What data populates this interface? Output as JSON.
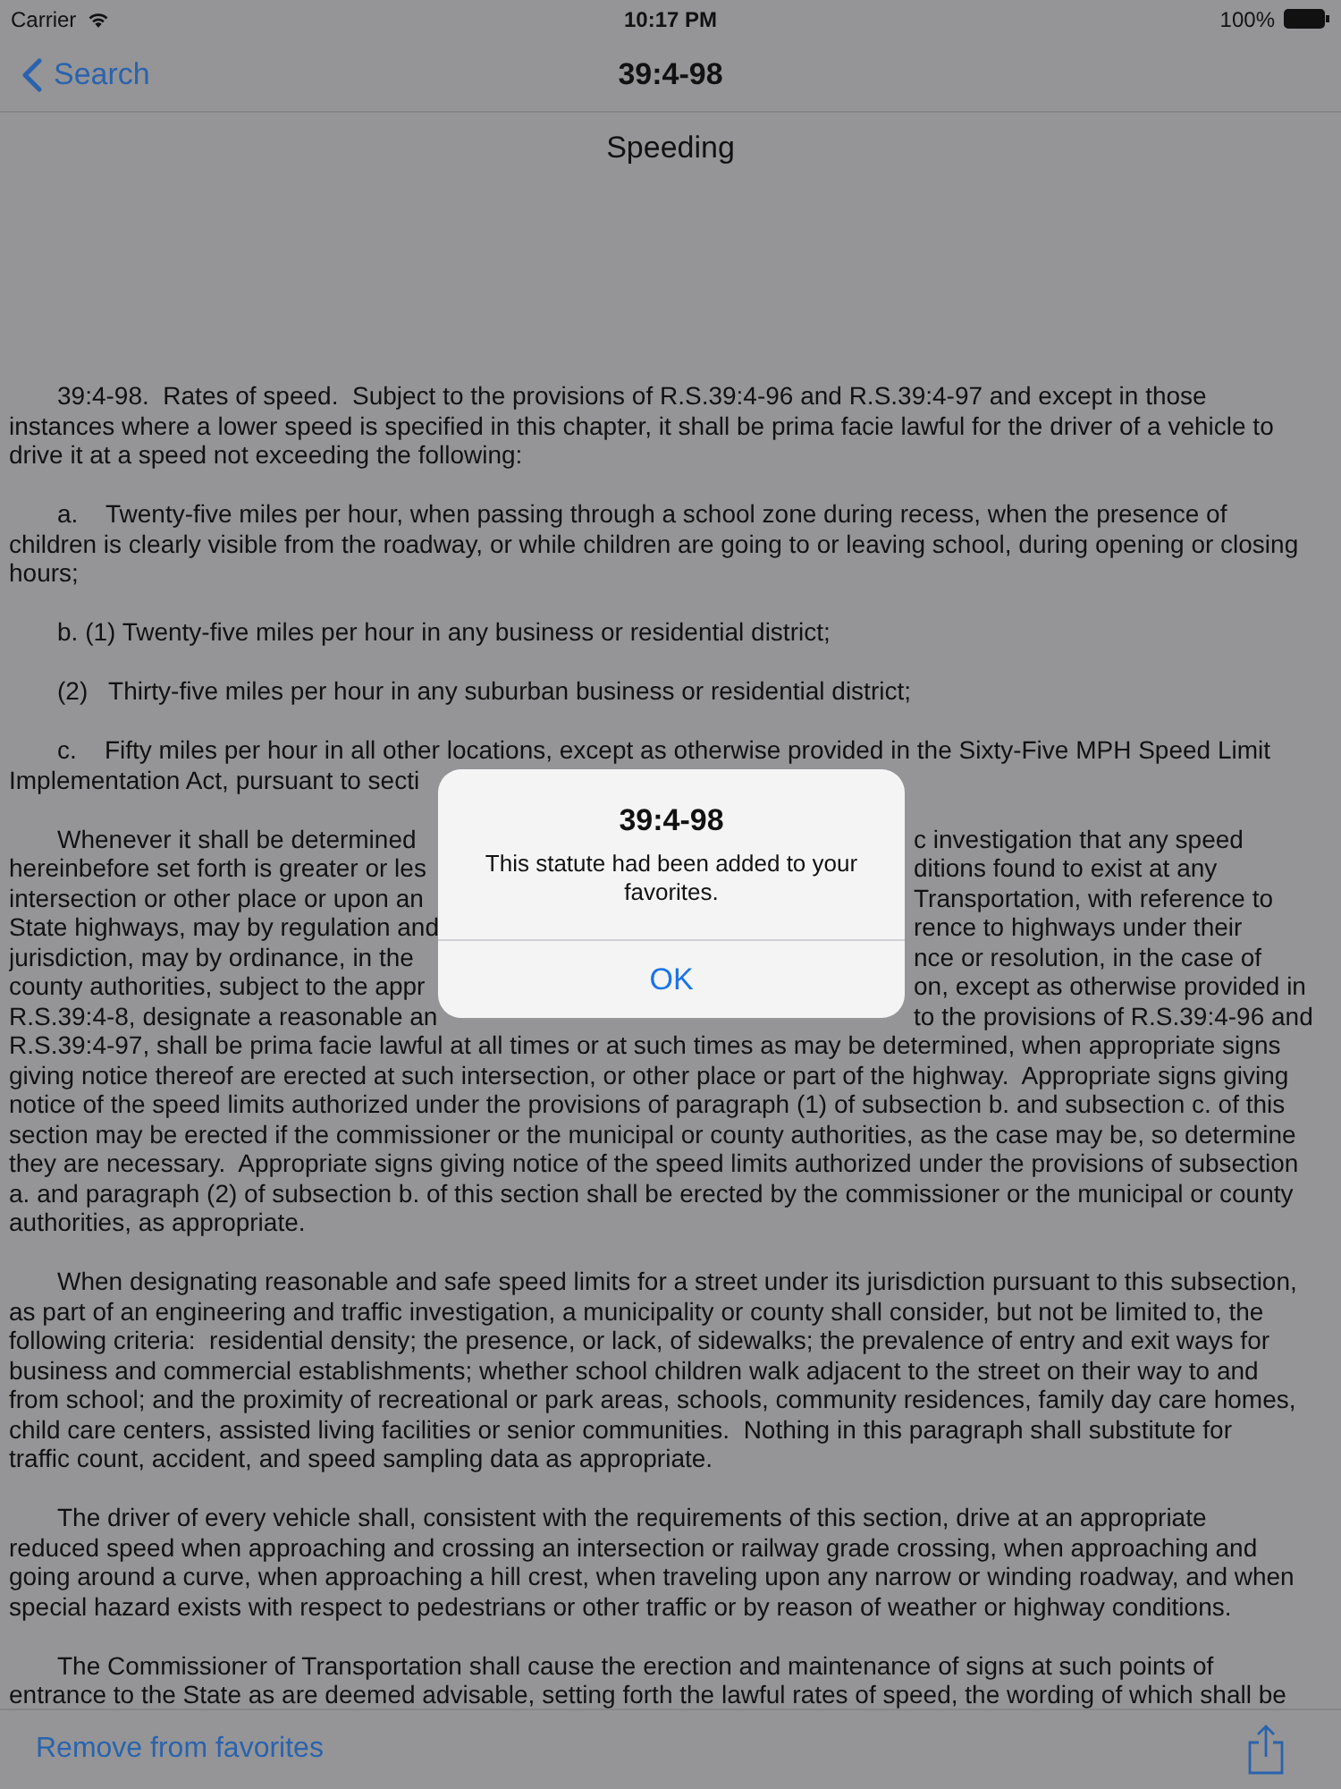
{
  "status_bar": {
    "carrier": "Carrier",
    "time": "10:17 PM",
    "battery": "100%"
  },
  "nav": {
    "back": "Search",
    "title": "39:4-98"
  },
  "document": {
    "heading": "Speeding",
    "paragraphs": [
      {
        "lines": [
          "39:4-98.  Rates of speed.  Subject to the provisions of R.S.39:4-96 and R.S.39:4-97 and except in those",
          "instances where a lower speed is specified in this chapter, it shall be prima facie lawful for the driver of a vehicle to",
          "drive it at a speed not exceeding the following:"
        ]
      },
      {
        "lines": [
          "a.    Twenty-five miles per hour, when passing through a school zone during recess, when the presence of",
          "children is clearly visible from the roadway, or while children are going to or leaving school, during opening or closing",
          "hours;"
        ]
      },
      {
        "lines": [
          "b. (1) Twenty-five miles per hour in any business or residential district;"
        ]
      },
      {
        "lines": [
          "(2)   Thirty-five miles per hour in any suburban business or residential district;"
        ]
      },
      {
        "lines": [
          "c.    Fifty miles per hour in all other locations, except as otherwise provided in the Sixty-Five MPH Speed Limit",
          {
            "left": "Implementation Act, pursuant to secti"
          }
        ]
      },
      {
        "lines": [
          {
            "left": "Whenever it shall be determined",
            "right": "c investigation that any speed"
          },
          {
            "left": "hereinbefore set forth is greater or les",
            "right": "ditions found to exist at any"
          },
          {
            "left": "intersection or other place or upon an",
            "right": "Transportation, with reference to"
          },
          {
            "left": "State highways, may by regulation and",
            "right": "rence to highways under their"
          },
          {
            "left": "jurisdiction, may by ordinance, in the",
            "right": "nce or resolution, in the case of"
          },
          {
            "left": "county authorities, subject to the appr",
            "right": "on, except as otherwise provided in"
          },
          {
            "left": "R.S.39:4-8, designate a reasonable an",
            "right": "to the provisions of R.S.39:4-96 and"
          },
          "R.S.39:4-97, shall be prima facie lawful at all times or at such times as may be determined, when appropriate signs",
          "giving notice thereof are erected at such intersection, or other place or part of the highway.  Appropriate signs giving",
          "notice of the speed limits authorized under the provisions of paragraph (1) of subsection b. and subsection c. of this",
          "section may be erected if the commissioner or the municipal or county authorities, as the case may be, so determine",
          "they are necessary.  Appropriate signs giving notice of the speed limits authorized under the provisions of subsection",
          "a. and paragraph (2) of subsection b. of this section shall be erected by the commissioner or the municipal or county",
          "authorities, as appropriate."
        ]
      },
      {
        "lines": [
          "When designating reasonable and safe speed limits for a street under its jurisdiction pursuant to this subsection,",
          "as part of an engineering and traffic investigation, a municipality or county shall consider, but not be limited to, the",
          "following criteria:  residential density; the presence, or lack, of sidewalks; the prevalence of entry and exit ways for",
          "business and commercial establishments; whether school children walk adjacent to the street on their way to and",
          "from school; and the proximity of recreational or park areas, schools, community residences, family day care homes,",
          "child care centers, assisted living facilities or senior communities.  Nothing in this paragraph shall substitute for",
          "traffic count, accident, and speed sampling data as appropriate."
        ]
      },
      {
        "lines": [
          "The driver of every vehicle shall, consistent with the requirements of this section, drive at an appropriate",
          "reduced speed when approaching and crossing an intersection or railway grade crossing, when approaching and",
          "going around a curve, when approaching a hill crest, when traveling upon any narrow or winding roadway, and when",
          "special hazard exists with respect to pedestrians or other traffic or by reason of weather or highway conditions."
        ]
      },
      {
        "lines": [
          "The Commissioner of Transportation shall cause the erection and maintenance of signs at such points of",
          "entrance to the State as are deemed advisable, setting forth the lawful rates of speed, the wording of which shall be"
        ]
      }
    ]
  },
  "toolbar": {
    "action": "Remove from favorites"
  },
  "alert": {
    "title": "39:4-98",
    "message": "This statute had been added to your favorites.",
    "button": "OK"
  }
}
